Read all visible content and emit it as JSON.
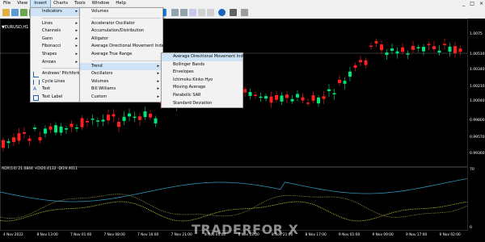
{
  "menubar": {
    "items": [
      {
        "label": "File"
      },
      {
        "label": "View"
      },
      {
        "label": "Insert"
      },
      {
        "label": "Charts"
      },
      {
        "label": "Tools"
      },
      {
        "label": "Window"
      },
      {
        "label": "Help"
      }
    ],
    "window_controls": [
      "_",
      "□",
      "×"
    ]
  },
  "chart": {
    "symbol_label": "▼EURUSD,H1  1.00",
    "indicator_label": "ADX(14) 21.0844  +DI20.4132  -DI19.4011",
    "price_ticks": [
      "1.0075",
      "1.00510",
      "1.00340",
      "1.00210",
      "1.00040",
      "0.99800",
      "0.99570",
      "0.99360"
    ],
    "indicator_ticks": [
      "70",
      "0"
    ],
    "time_ticks": [
      "4 Nov 2022",
      "8 Nov 13:00",
      "7 Nov 01:00",
      "7 Nov 08:00",
      "7 Nov 16:00",
      "7 Nov 21:00",
      "8 Nov 05:00",
      "8 Nov 13:00",
      "8 Nov 21:00",
      "8 Nov 17:00",
      "9 Nov 01:00",
      "9 Nov 09:00",
      "9 Nov 17:00",
      "9 Nov 02:00"
    ]
  },
  "insert_menu": {
    "items": [
      {
        "label": "Indicators",
        "submenu": true
      },
      {
        "label": "Lines",
        "submenu": true
      },
      {
        "label": "Channels",
        "submenu": true
      },
      {
        "label": "Gann",
        "submenu": true
      },
      {
        "label": "Fibonacci",
        "submenu": true
      },
      {
        "label": "Shapes",
        "submenu": true
      },
      {
        "label": "Arrows",
        "submenu": true
      },
      {
        "label": "Andrews' Pitchfork",
        "submenu": false
      },
      {
        "label": "Cycle Lines",
        "submenu": false
      },
      {
        "label": "Text",
        "submenu": false
      },
      {
        "label": "Text Label",
        "submenu": false
      }
    ]
  },
  "indicators_menu": {
    "items": [
      {
        "label": "Volumes"
      },
      {
        "label": "Accelerator Oscillator"
      },
      {
        "label": "Accumulation/Distribution"
      },
      {
        "label": "Alligator"
      },
      {
        "label": "Average Directional Movement Index"
      },
      {
        "label": "Average True Range"
      },
      {
        "label": "Trend",
        "submenu": true
      },
      {
        "label": "Oscillators",
        "submenu": true
      },
      {
        "label": "Volumes",
        "submenu": true
      },
      {
        "label": "Bill Williams",
        "submenu": true
      },
      {
        "label": "Custom",
        "submenu": true
      }
    ]
  },
  "trend_menu": {
    "items": [
      {
        "label": "Average Directional Movement Index"
      },
      {
        "label": "Bollinger Bands"
      },
      {
        "label": "Envelopes"
      },
      {
        "label": "Ichimoku Kinko Hyo"
      },
      {
        "label": "Moving Average"
      },
      {
        "label": "Parabolic SAR"
      },
      {
        "label": "Standard Deviation"
      }
    ]
  },
  "watermark": "TRADERFOR X",
  "colors": {
    "bull": "#00e676",
    "bear": "#ff1f1f",
    "adx_line": "#2d8fb0",
    "plus_di": "#c8c832",
    "minus_di": "#8a8a3a",
    "menu_bg": "#f2f2f2",
    "menu_sel": "#cfe3f6"
  }
}
